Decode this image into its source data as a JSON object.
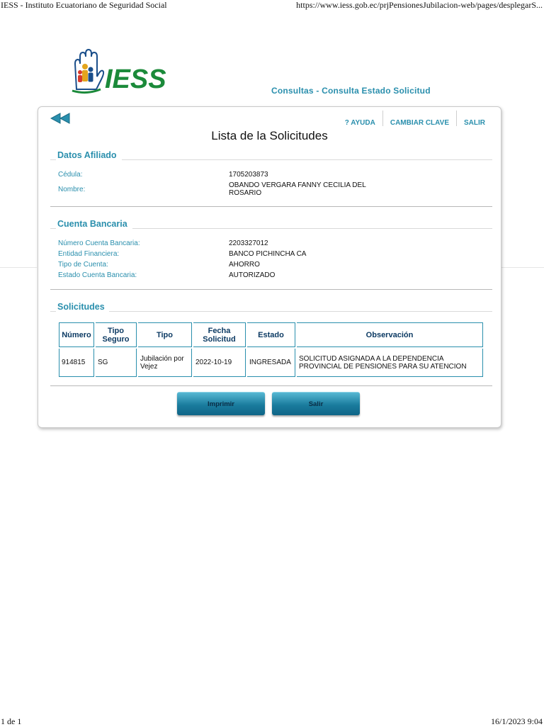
{
  "print": {
    "header_left": "IESS - Instituto Ecuatoriano de Seguridad Social",
    "header_right": "https://www.iess.gob.ec/prjPensionesJubilacion-web/pages/desplegarS...",
    "footer_left": "1 de 1",
    "footer_right": "16/1/2023 9:04"
  },
  "brand": {
    "logo_text": "IESS",
    "subtitle": "Consultas - Consulta Estado Solicitud",
    "accent_color": "#2a8fad",
    "logo_green": "#1b8a3a"
  },
  "nav": {
    "back_icon": "double-arrow-left-icon",
    "help": "? AYUDA",
    "change_password": "CAMBIAR CLAVE",
    "logout": "SALIR"
  },
  "page_title": "Lista de la Solicitudes",
  "afiliado": {
    "title": "Datos Afiliado",
    "cedula_label": "Cédula:",
    "cedula": "1705203873",
    "nombre_label": "Nombre:",
    "nombre": "OBANDO VERGARA FANNY CECILIA DEL ROSARIO"
  },
  "cuenta": {
    "title": "Cuenta Bancaria",
    "numero_label": "Número Cuenta Bancaria:",
    "numero": "2203327012",
    "entidad_label": "Entidad Financiera:",
    "entidad": "BANCO PICHINCHA CA",
    "tipo_label": "Tipo de Cuenta:",
    "tipo": "AHORRO",
    "estado_label": "Estado Cuenta Bancaria:",
    "estado": "AUTORIZADO"
  },
  "solicitudes": {
    "title": "Solicitudes",
    "columns": [
      "Número",
      "Tipo Seguro",
      "Tipo",
      "Fecha Solicitud",
      "Estado",
      "Observación"
    ],
    "rows": [
      [
        "914815",
        "SG",
        "Jubilación por Vejez",
        "2022-10-19",
        "INGRESADA",
        "SOLICITUD ASIGNADA A LA DEPENDENCIA PROVINCIAL DE PENSIONES PARA SU ATENCION"
      ]
    ]
  },
  "buttons": {
    "print": "Imprimir",
    "exit": "Salir"
  }
}
